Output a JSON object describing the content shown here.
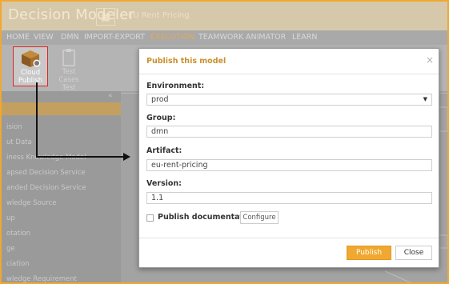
{
  "app": {
    "title": "Decision Modeler",
    "document_title": "EU Rent Pricing"
  },
  "menu": [
    {
      "label": "HOME"
    },
    {
      "label": "VIEW"
    },
    {
      "label": "DMN"
    },
    {
      "label": "IMPORT-EXPORT"
    },
    {
      "label": "EXECUTION",
      "active": true
    },
    {
      "label": "TEAMWORK"
    },
    {
      "label": "ANIMATOR"
    },
    {
      "label": "LEARN"
    }
  ],
  "ribbon": {
    "cloud_publish": {
      "label_line1": "Cloud",
      "label_line2": "Publish",
      "icon": "cloud-package-icon"
    },
    "test_cases": {
      "label_line1": "Test",
      "label_line2": "Cases",
      "label_line3": "Test",
      "icon": "clipboard-icon"
    }
  },
  "left_panel": {
    "search_text": "",
    "items": [
      "ision",
      "ut Data",
      "iness Knowledge Model",
      "apsed Decision Service",
      "anded Decision Service",
      "wledge Source",
      "up",
      "otation",
      "ge",
      "ciation",
      "wledge Requirement"
    ]
  },
  "modal": {
    "title": "Publish this model",
    "close_symbol": "×",
    "environment_label": "Environment:",
    "environment_value": "prod",
    "group_label": "Group:",
    "group_value": "dmn",
    "artifact_label": "Artifact:",
    "artifact_value": "eu-rent-pricing",
    "version_label": "Version:",
    "version_value": "1.1",
    "publish_doc_label": "Publish documentation",
    "configure_label": "Configure",
    "publish_label": "Publish",
    "close_label": "Close"
  },
  "colors": {
    "accent": "#f0a830",
    "highlight": "#e02424"
  }
}
